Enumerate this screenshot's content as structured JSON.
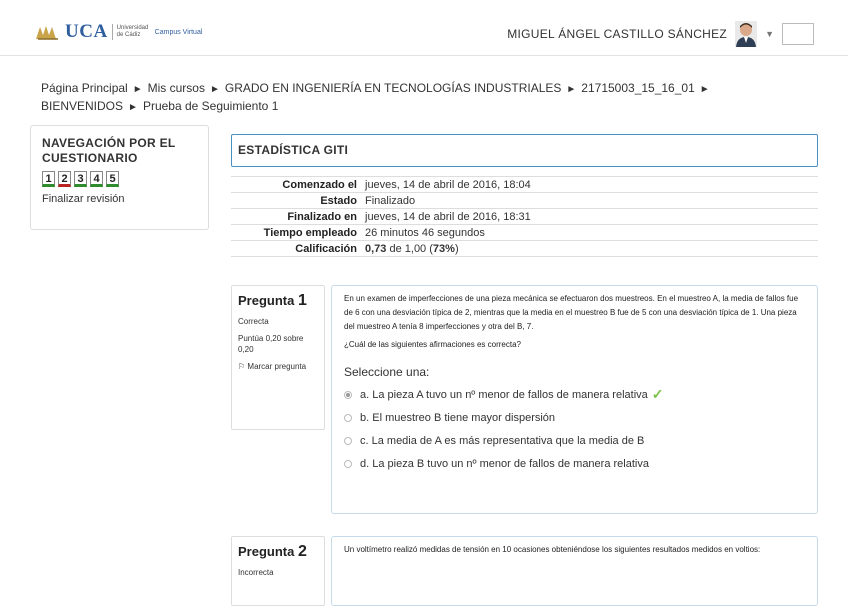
{
  "header": {
    "logo_text": "UCA",
    "logo_sub": "Universidad de Cádiz",
    "logo_campus": "Campus Virtual",
    "user_name": "MIGUEL ÁNGEL CASTILLO SÁNCHEZ"
  },
  "breadcrumb": [
    "Página Principal",
    "Mis cursos",
    "GRADO EN INGENIERÍA EN TECNOLOGÍAS INDUSTRIALES",
    "21715003_15_16_01",
    "BIENVENIDOS",
    "Prueba de Seguimiento 1"
  ],
  "nav": {
    "title": "NAVEGACIÓN POR EL CUESTIONARIO",
    "questions": [
      "1",
      "2",
      "3",
      "4",
      "5"
    ],
    "finish_label": "Finalizar revisión"
  },
  "quiz_title": "ESTADÍSTICA GITI",
  "summary": [
    {
      "label": "Comenzado el",
      "value": "jueves, 14 de abril de 2016, 18:04"
    },
    {
      "label": "Estado",
      "value": "Finalizado"
    },
    {
      "label": "Finalizado en",
      "value": "jueves, 14 de abril de 2016, 18:31"
    },
    {
      "label": "Tiempo empleado",
      "value": "26 minutos 46 segundos"
    },
    {
      "label": "Calificación",
      "value_bold": "0,73",
      "value_mid": " de 1,00 (",
      "value_pct": "73%",
      "value_end": ")"
    }
  ],
  "q1": {
    "label": "Pregunta",
    "number": "1",
    "state": "Correcta",
    "points": "Puntúa 0,20 sobre 0,20",
    "flag": "Marcar pregunta",
    "text": "En un examen de imperfecciones de una pieza mecánica se efectuaron dos muestreos. En el muestreo A, la media de fallos fue de 6 con una desviación típica de 2, mientras que la media en el muestreo B fue de 5 con una desviación típica de 1. Una pieza del muestreo A tenía 8 imperfecciones y otra del B, 7.",
    "prompt": "¿Cuál de las siguientes afirmaciones es correcta?",
    "select_label": "Seleccione una:",
    "answers": [
      "a. La pieza A tuvo un nº menor de fallos de manera relativa",
      "b. El muestreo B tiene mayor dispersión",
      "c. La media de A es más representativa que la media de B",
      "d. La pieza B tuvo un nº menor de fallos de manera relativa"
    ],
    "selected_index": 0,
    "checkmark": "✓"
  },
  "q2": {
    "label": "Pregunta",
    "number": "2",
    "state": "Incorrecta",
    "text": "Un voltímetro realizó medidas de tensión en 10 ocasiones obteniéndose los siguientes resultados medidos en voltios:"
  },
  "colors": {
    "correct": "#2e8b2e",
    "incorrect": "#b22222",
    "accent": "#4a90c2",
    "check": "#7cc04b"
  }
}
